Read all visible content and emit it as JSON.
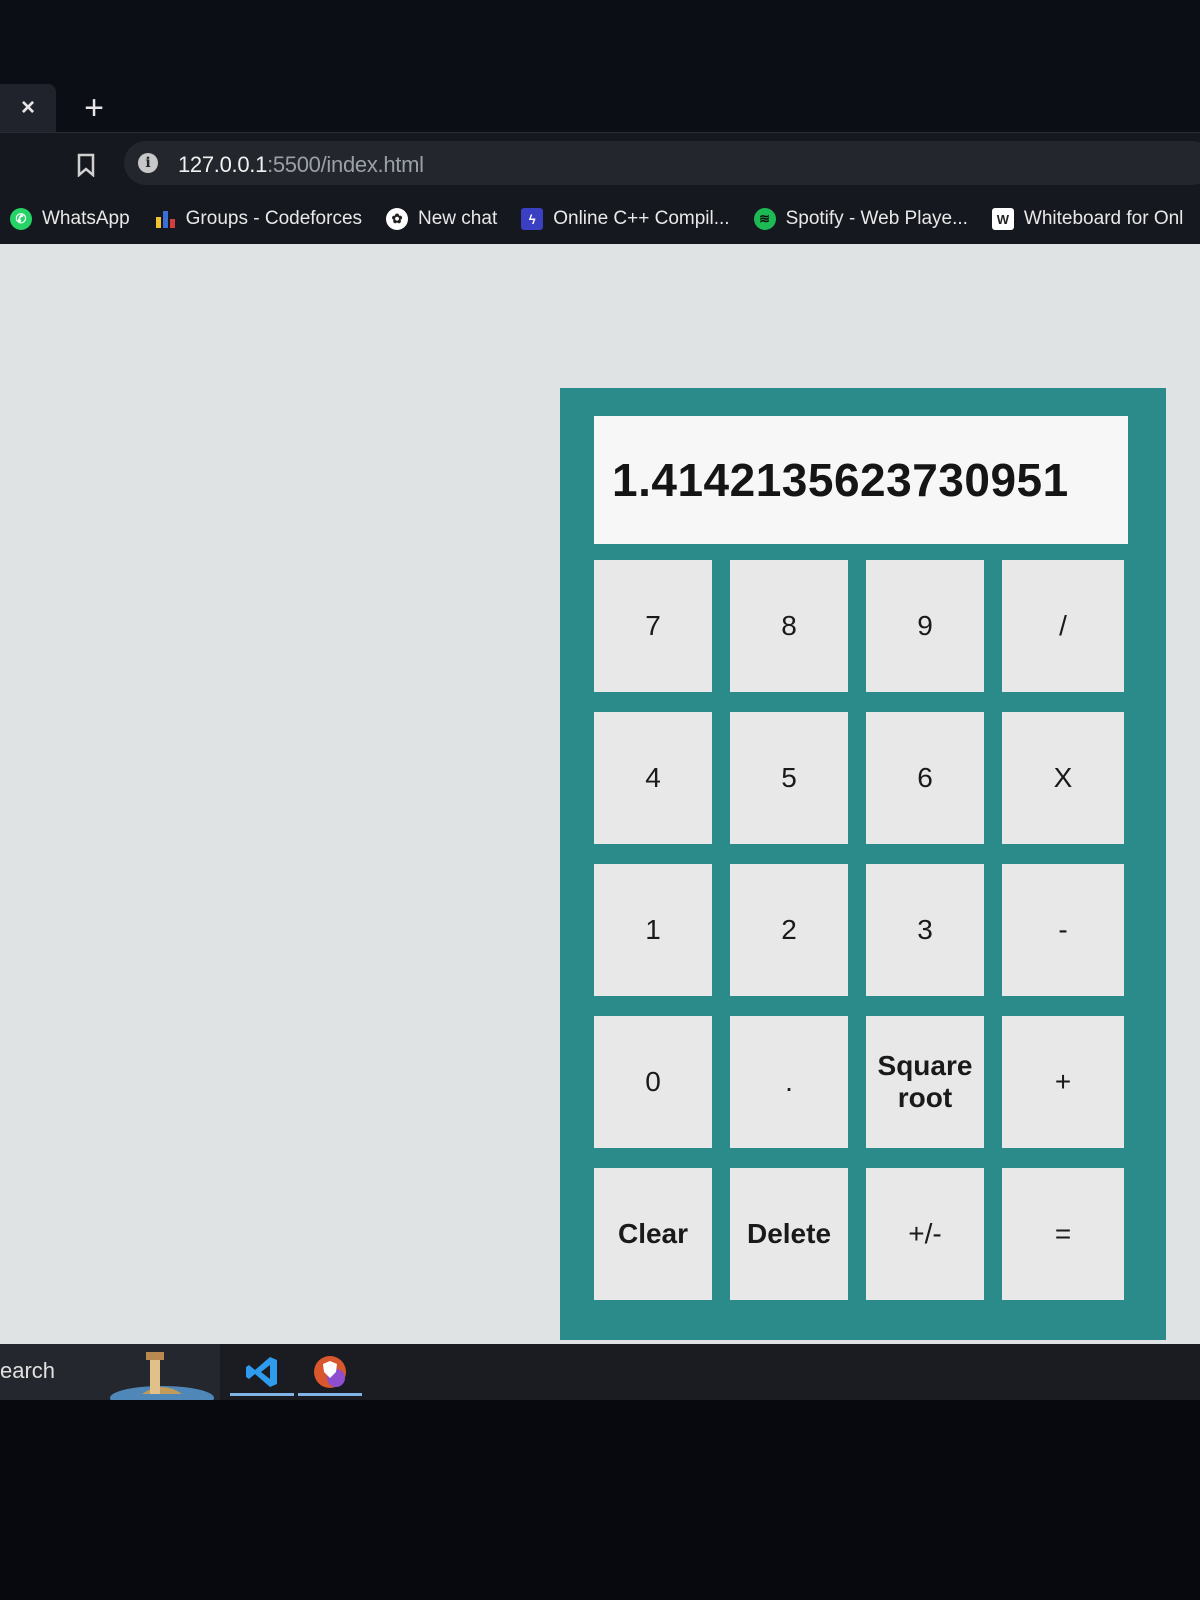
{
  "browser": {
    "tab_close_glyph": "×",
    "new_tab_glyph": "+",
    "url_host": "127.0.0.1",
    "url_rest": ":5500/index.html",
    "bookmarks": [
      {
        "label": "WhatsApp",
        "icon": "whatsapp-icon"
      },
      {
        "label": "Groups - Codeforces",
        "icon": "codeforces-icon"
      },
      {
        "label": "New chat",
        "icon": "chatgpt-icon"
      },
      {
        "label": "Online C++ Compil...",
        "icon": "lightning-icon"
      },
      {
        "label": "Spotify - Web Playe...",
        "icon": "spotify-icon"
      },
      {
        "label": "Whiteboard for Onl",
        "icon": "whiteboard-icon"
      }
    ]
  },
  "calculator": {
    "display_value": "1.4142135623730951",
    "accent_color": "#2b8a8a",
    "keys": [
      {
        "label": "7",
        "name": "key-7"
      },
      {
        "label": "8",
        "name": "key-8"
      },
      {
        "label": "9",
        "name": "key-9"
      },
      {
        "label": "/",
        "name": "key-divide"
      },
      {
        "label": "4",
        "name": "key-4"
      },
      {
        "label": "5",
        "name": "key-5"
      },
      {
        "label": "6",
        "name": "key-6"
      },
      {
        "label": "X",
        "name": "key-multiply"
      },
      {
        "label": "1",
        "name": "key-1"
      },
      {
        "label": "2",
        "name": "key-2"
      },
      {
        "label": "3",
        "name": "key-3"
      },
      {
        "label": "-",
        "name": "key-subtract"
      },
      {
        "label": "0",
        "name": "key-0"
      },
      {
        "label": ".",
        "name": "key-decimal"
      },
      {
        "label": "Square root",
        "name": "key-square-root"
      },
      {
        "label": "+",
        "name": "key-add"
      },
      {
        "label": "Clear",
        "name": "key-clear"
      },
      {
        "label": "Delete",
        "name": "key-delete"
      },
      {
        "label": "+/-",
        "name": "key-negate"
      },
      {
        "label": "=",
        "name": "key-equals"
      }
    ]
  },
  "taskbar": {
    "search_text": "earch",
    "apps": [
      "vscode-icon",
      "brave-icon"
    ]
  }
}
